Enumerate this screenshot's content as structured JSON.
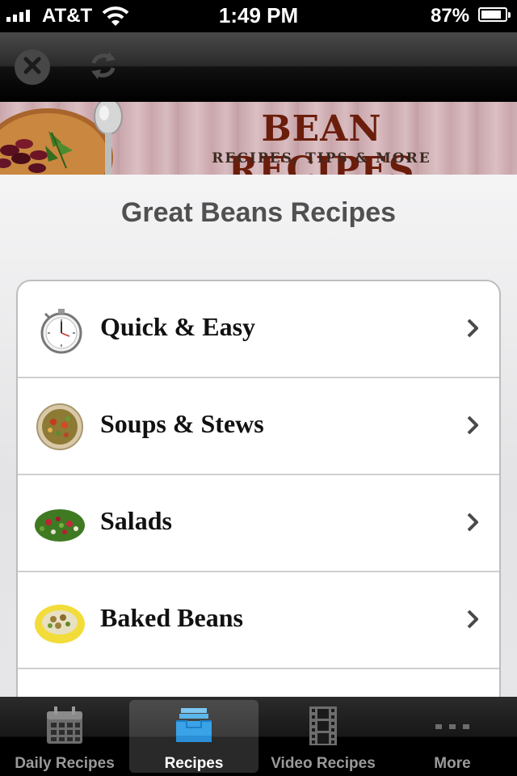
{
  "status_bar": {
    "carrier": "AT&T",
    "time": "1:49 PM",
    "battery_percent": "87%",
    "battery_level": 0.87,
    "icons": [
      "signal-bars-icon",
      "wifi-icon",
      "battery-icon"
    ]
  },
  "toolbar": {
    "close_icon": "close-icon",
    "refresh_icon": "refresh-icon"
  },
  "banner": {
    "title": "BEAN RECIPES",
    "subtitle": "RECIPES, TIPS & MORE"
  },
  "main": {
    "title": "Great Beans Recipes",
    "items": [
      {
        "label": "Quick & Easy",
        "icon": "stopwatch-icon"
      },
      {
        "label": "Soups & Stews",
        "icon": "soup-bowl-icon"
      },
      {
        "label": "Salads",
        "icon": "salad-icon"
      },
      {
        "label": "Baked Beans",
        "icon": "baked-beans-icon"
      },
      {
        "label": "",
        "icon": ""
      }
    ]
  },
  "tab_bar": {
    "tabs": [
      {
        "label": "Daily Recipes",
        "icon": "calendar-icon",
        "active": false
      },
      {
        "label": "Recipes",
        "icon": "inbox-tray-icon",
        "active": true
      },
      {
        "label": "Video Recipes",
        "icon": "film-strip-icon",
        "active": false
      },
      {
        "label": "More",
        "icon": "more-dots-icon",
        "active": false
      }
    ]
  },
  "colors": {
    "banner_title": "#6b1d0c",
    "page_title": "#505050",
    "active_tab_icon": "#3aa3e8"
  }
}
